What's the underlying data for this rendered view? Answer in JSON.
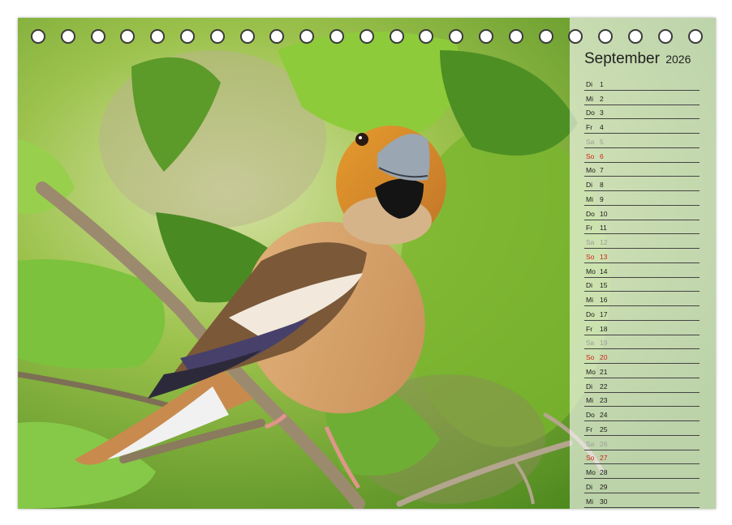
{
  "calendar": {
    "month": "September",
    "year": "2026",
    "days": [
      {
        "wd": "Di",
        "d": "1",
        "type": "weekday"
      },
      {
        "wd": "Mi",
        "d": "2",
        "type": "weekday"
      },
      {
        "wd": "Do",
        "d": "3",
        "type": "weekday"
      },
      {
        "wd": "Fr",
        "d": "4",
        "type": "weekday"
      },
      {
        "wd": "Sa",
        "d": "5",
        "type": "sat"
      },
      {
        "wd": "So",
        "d": "6",
        "type": "sun"
      },
      {
        "wd": "Mo",
        "d": "7",
        "type": "weekday"
      },
      {
        "wd": "Di",
        "d": "8",
        "type": "weekday"
      },
      {
        "wd": "Mi",
        "d": "9",
        "type": "weekday"
      },
      {
        "wd": "Do",
        "d": "10",
        "type": "weekday"
      },
      {
        "wd": "Fr",
        "d": "11",
        "type": "weekday"
      },
      {
        "wd": "Sa",
        "d": "12",
        "type": "sat"
      },
      {
        "wd": "So",
        "d": "13",
        "type": "sun"
      },
      {
        "wd": "Mo",
        "d": "14",
        "type": "weekday"
      },
      {
        "wd": "Di",
        "d": "15",
        "type": "weekday"
      },
      {
        "wd": "Mi",
        "d": "16",
        "type": "weekday"
      },
      {
        "wd": "Do",
        "d": "17",
        "type": "weekday"
      },
      {
        "wd": "Fr",
        "d": "18",
        "type": "weekday"
      },
      {
        "wd": "Sa",
        "d": "19",
        "type": "sat"
      },
      {
        "wd": "So",
        "d": "20",
        "type": "sun"
      },
      {
        "wd": "Mo",
        "d": "21",
        "type": "weekday"
      },
      {
        "wd": "Di",
        "d": "22",
        "type": "weekday"
      },
      {
        "wd": "Mi",
        "d": "23",
        "type": "weekday"
      },
      {
        "wd": "Do",
        "d": "24",
        "type": "weekday"
      },
      {
        "wd": "Fr",
        "d": "25",
        "type": "weekday"
      },
      {
        "wd": "Sa",
        "d": "26",
        "type": "sat"
      },
      {
        "wd": "So",
        "d": "27",
        "type": "sun"
      },
      {
        "wd": "Mo",
        "d": "28",
        "type": "weekday"
      },
      {
        "wd": "Di",
        "d": "29",
        "type": "weekday"
      },
      {
        "wd": "Mi",
        "d": "30",
        "type": "weekday"
      }
    ]
  },
  "colors": {
    "sunday": "#d1241c",
    "saturday": "#9c9c9c",
    "text": "#1a1a1a"
  },
  "photo": {
    "icon": "hawfinch-bird-photo"
  }
}
